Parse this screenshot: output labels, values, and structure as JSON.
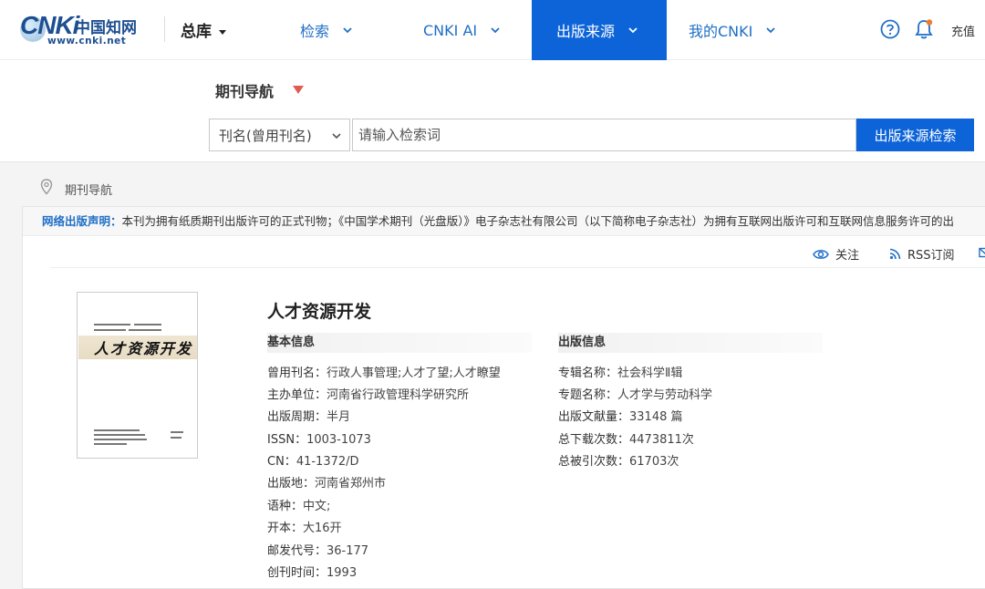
{
  "header": {
    "logo": {
      "brand": "CNKi",
      "chinese": "中国知网",
      "url": "www.cnki.net"
    },
    "db_selector": "总库",
    "nav": [
      {
        "label": "检索",
        "active": false
      },
      {
        "label": "CNKI AI",
        "active": false
      },
      {
        "label": "出版来源",
        "active": true
      },
      {
        "label": "我的CNKI",
        "active": false
      }
    ],
    "recharge": "充值"
  },
  "search": {
    "title": "期刊导航",
    "field": "刊名(曾用刊名)",
    "placeholder": "请输入检索词",
    "button": "出版来源检索"
  },
  "breadcrumb": {
    "text": "期刊导航"
  },
  "notice": {
    "label": "网络出版声明：",
    "text": "本刊为拥有纸质期刊出版许可的正式刊物；《中国学术期刊（光盘版）》电子杂志社有限公司（以下简称电子杂志社）为拥有互联网出版许可和互联网信息服务许可的出"
  },
  "toolbar": {
    "follow": "关注",
    "rss": "RSS订阅"
  },
  "cover": {
    "title": "人才资源开发"
  },
  "journal": {
    "title": "人才资源开发",
    "basic_head": "基本信息",
    "pub_head": "出版信息",
    "basic": [
      {
        "key": "曾用刊名：",
        "value": "行政人事管理;人才了望;人才瞭望"
      },
      {
        "key": "主办单位：",
        "value": "河南省行政管理科学研究所"
      },
      {
        "key": "出版周期：",
        "value": "半月"
      },
      {
        "key": "ISSN：",
        "value": "1003-1073"
      },
      {
        "key": "CN：",
        "value": "41-1372/D"
      },
      {
        "key": "出版地：",
        "value": "河南省郑州市"
      },
      {
        "key": "语种：",
        "value": "中文;"
      },
      {
        "key": "开本：",
        "value": "大16开"
      },
      {
        "key": "邮发代号：",
        "value": "36-177"
      },
      {
        "key": "创刊时间：",
        "value": "1993"
      }
    ],
    "pub": [
      {
        "key": "专辑名称：",
        "value": "社会科学Ⅱ辑"
      },
      {
        "key": "专题名称：",
        "value": "人才学与劳动科学"
      },
      {
        "key": "出版文献量：",
        "value": "33148 篇"
      },
      {
        "key": "总下载次数：",
        "value": "4473811次"
      },
      {
        "key": "总被引次数：",
        "value": "61703次"
      }
    ]
  },
  "colors": {
    "brand_blue": "#0d64d8",
    "link_blue": "#1f6fc6",
    "accent_red": "#e35b4f"
  }
}
